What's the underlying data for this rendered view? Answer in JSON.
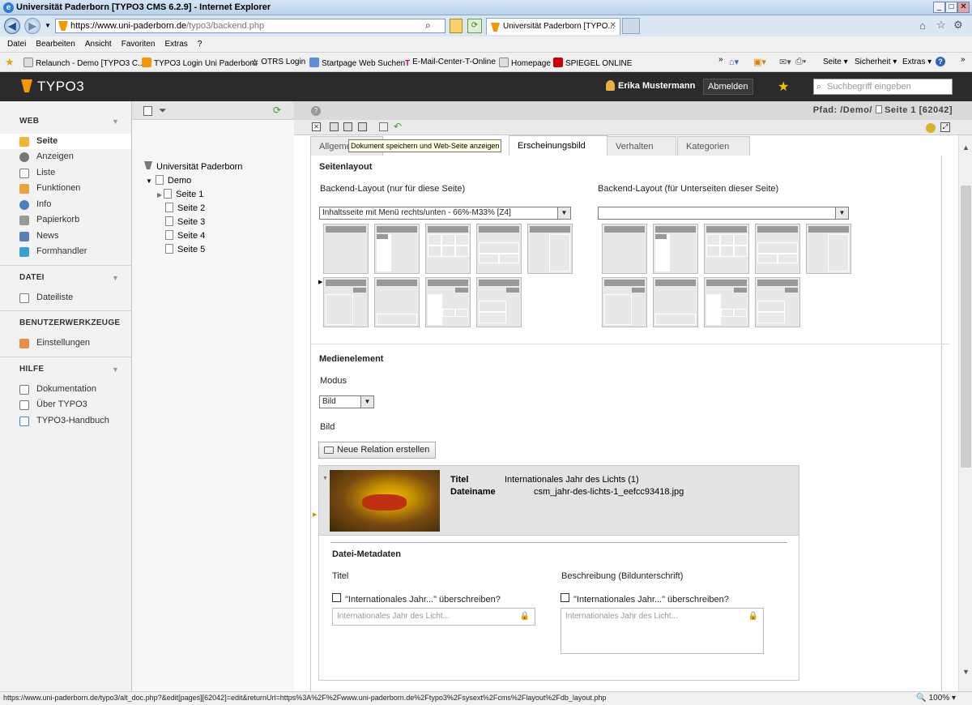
{
  "window": {
    "title": "Universität Paderborn [TYPO3 CMS 6.2.9] - Internet Explorer"
  },
  "browser": {
    "url_host": "https://www.uni-paderborn.de",
    "url_path": "/typo3/backend.php",
    "tab_title": "Universität Paderborn [TYPO...",
    "menu": [
      "Datei",
      "Bearbeiten",
      "Ansicht",
      "Favoriten",
      "Extras",
      "?"
    ],
    "favorites": [
      "Relaunch - Demo [TYPO3 C...",
      "TYPO3 Login Uni Paderborn",
      "OTRS  Login",
      "Startpage Web Suchen",
      "E-Mail-Center-T-Online",
      "Homepage",
      "SPIEGEL ONLINE"
    ],
    "cmd": {
      "seite": "Seite ▾",
      "sicherheit": "Sicherheit ▾",
      "extras": "Extras ▾"
    },
    "status_url": "https://www.uni-paderborn.de/typo3/alt_doc.php?&edit[pages][62042]=edit&returnUrl=https%3A%2F%2Fwww.uni-paderborn.de%2Ftypo3%2Fsysext%2Fcms%2Flayout%2Fdb_layout.php",
    "zoom": "100%"
  },
  "typo3": {
    "logo": "TYPO3",
    "user": "Erika Mustermann",
    "logout": "Abmelden",
    "search_placeholder": "Suchbegriff eingeben",
    "pfad_label": "Pfad:",
    "pfad_value": "/Demo/",
    "page_ref": "Seite 1 [62042]"
  },
  "modules": {
    "web": "WEB",
    "web_items": [
      "Seite",
      "Anzeigen",
      "Liste",
      "Funktionen",
      "Info",
      "Papierkorb",
      "News",
      "Formhandler"
    ],
    "datei": "DATEI",
    "datei_items": [
      "Dateiliste"
    ],
    "benutzer": "BENUTZERWERKZEUGE",
    "benutzer_items": [
      "Einstellungen"
    ],
    "hilfe": "HILFE",
    "hilfe_items": [
      "Dokumentation",
      "Über TYPO3",
      "TYPO3-Handbuch"
    ]
  },
  "tree": {
    "root": "Universität Paderborn",
    "demo": "Demo",
    "pages": [
      "Seite 1",
      "Seite 2",
      "Seite 3",
      "Seite 4",
      "Seite 5"
    ]
  },
  "tooltip": "Dokument speichern und Web-Seite anzeigen",
  "tabs": [
    "Allgeme",
    "Erscheinungsbild",
    "Verhalten",
    "Kategorien"
  ],
  "seitenlayout": {
    "heading": "Seitenlayout",
    "label_this": "Backend-Layout (nur für diese Seite)",
    "label_sub": "Backend-Layout (für Unterseiten dieser Seite)",
    "value_this": "Inhaltsseite mit Menü rechts/unten - 66%-M33% [Z4]",
    "value_sub": ""
  },
  "medien": {
    "heading": "Medienelement",
    "modus_label": "Modus",
    "modus_value": "Bild",
    "bild_label": "Bild",
    "new_relation": "Neue Relation erstellen",
    "titel_key": "Titel",
    "titel_val": "Internationales Jahr des Lichts (1)",
    "datei_key": "Dateiname",
    "datei_val": "csm_jahr-des-lichts-1_eefcc93418.jpg",
    "meta_heading": "Datei-Metadaten",
    "meta_titel": "Titel",
    "meta_beschr": "Beschreibung (Bildunterschrift)",
    "override_1": "\"Internationales Jahr...\" überschreiben?",
    "override_2": "\"Internationales Jahr...\" überschreiben?",
    "placeholder_1": "Internationales Jahr des Licht...",
    "placeholder_2": "Internationales Jahr des Licht..."
  }
}
